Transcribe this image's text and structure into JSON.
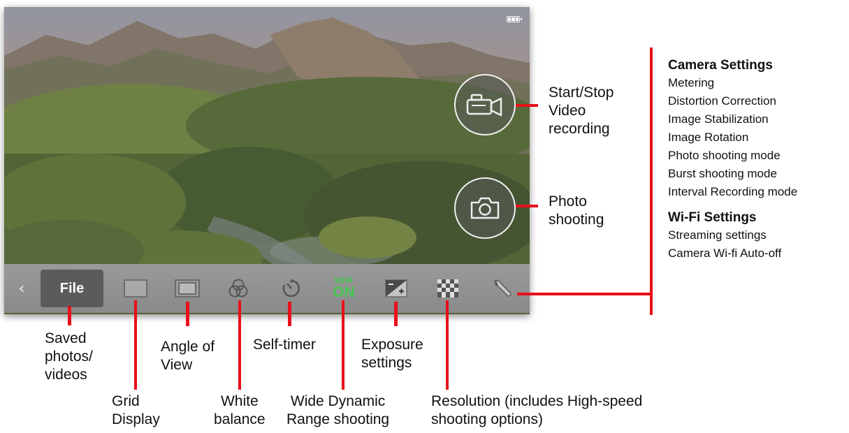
{
  "toolbar": {
    "back_glyph": "‹",
    "file_label": "File",
    "wdr_line1": "WDR",
    "wdr_line2": "ON"
  },
  "icons": [
    "chevron-left-icon",
    "grid-display-icon",
    "angle-of-view-icon",
    "white-balance-icon",
    "self-timer-icon",
    "wdr-icon",
    "exposure-icon",
    "resolution-icon",
    "wrench-icon",
    "video-camera-icon",
    "camera-icon",
    "battery-icon"
  ],
  "colors": {
    "callout_red": "#e8101a",
    "wdr_green": "#46c850",
    "toolbar": "#8e8e8e",
    "file_button": "#5b5b5b"
  },
  "labels": {
    "video": [
      "Start/Stop",
      "Video",
      "recording"
    ],
    "photo": [
      "Photo",
      "shooting"
    ],
    "saved": [
      "Saved",
      "photos/",
      "videos"
    ],
    "grid": [
      "Grid",
      "Display"
    ],
    "angle": [
      "Angle of",
      "View"
    ],
    "white_balance": [
      "White",
      "balance"
    ],
    "self_timer": [
      "Self-timer"
    ],
    "wdr": [
      "Wide Dynamic",
      "Range shooting"
    ],
    "exposure": [
      "Exposure",
      "settings"
    ],
    "resolution": [
      "Resolution (includes High-speed",
      "shooting options)"
    ]
  },
  "camera_settings": {
    "heading": "Camera Settings",
    "items": [
      "Metering",
      "Distortion Correction",
      "Image Stabilization",
      "Image Rotation",
      "Photo shooting mode",
      "Burst shooting mode",
      "Interval Recording mode"
    ]
  },
  "wifi_settings": {
    "heading": "Wi-Fi Settings",
    "items": [
      "Streaming settings",
      "Camera Wi-fi Auto-off"
    ]
  }
}
